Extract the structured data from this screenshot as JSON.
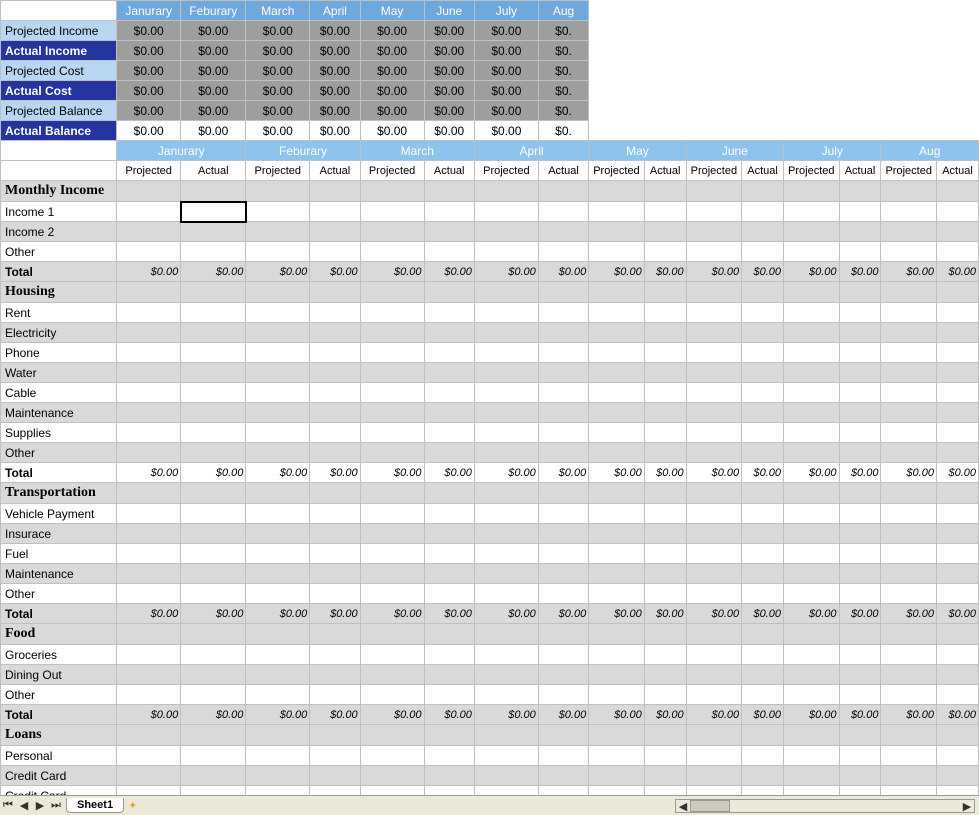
{
  "months": [
    "Janurary",
    "Feburary",
    "March",
    "April",
    "May",
    "June",
    "July",
    "Aug"
  ],
  "summary_rows": [
    {
      "label": "Projected Income",
      "style": "light",
      "vals": [
        "$0.00",
        "$0.00",
        "$0.00",
        "$0.00",
        "$0.00",
        "$0.00",
        "$0.00",
        "$0."
      ]
    },
    {
      "label": "Actual Income",
      "style": "dark",
      "vals": [
        "$0.00",
        "$0.00",
        "$0.00",
        "$0.00",
        "$0.00",
        "$0.00",
        "$0.00",
        "$0."
      ]
    },
    {
      "label": "Projected Cost",
      "style": "light",
      "vals": [
        "$0.00",
        "$0.00",
        "$0.00",
        "$0.00",
        "$0.00",
        "$0.00",
        "$0.00",
        "$0."
      ]
    },
    {
      "label": "Actual Cost",
      "style": "dark",
      "vals": [
        "$0.00",
        "$0.00",
        "$0.00",
        "$0.00",
        "$0.00",
        "$0.00",
        "$0.00",
        "$0."
      ]
    },
    {
      "label": "Projected Balance",
      "style": "light",
      "vals": [
        "$0.00",
        "$0.00",
        "$0.00",
        "$0.00",
        "$0.00",
        "$0.00",
        "$0.00",
        "$0."
      ]
    },
    {
      "label": "Actual Balance",
      "style": "dark",
      "white_body": true,
      "vals": [
        "$0.00",
        "$0.00",
        "$0.00",
        "$0.00",
        "$0.00",
        "$0.00",
        "$0.00",
        "$0."
      ]
    }
  ],
  "subcol_labels": {
    "projected": "Projected",
    "actual": "Actual"
  },
  "sections": [
    {
      "title": "Monthly Income",
      "items": [
        "Income 1",
        "Income 2",
        "Other"
      ],
      "has_total": true
    },
    {
      "title": "Housing",
      "items": [
        "Rent",
        "Electricity",
        "Phone",
        "Water",
        "Cable",
        "Maintenance",
        "Supplies",
        "Other"
      ],
      "has_total": true
    },
    {
      "title": "Transportation",
      "items": [
        "Vehicle Payment",
        "Insurace",
        "Fuel",
        "Maintenance",
        "Other"
      ],
      "has_total": true
    },
    {
      "title": "Food",
      "items": [
        "Groceries",
        "Dining Out",
        "Other"
      ],
      "has_total": true
    },
    {
      "title": "Loans",
      "items": [
        "Personal",
        "Credit Card",
        "Credit Card"
      ],
      "has_total": false
    }
  ],
  "total_label": "Total",
  "total_value": "$0.00",
  "selected_cell": {
    "section": 0,
    "item": 0,
    "col": 1
  },
  "sheet_tab": "Sheet1"
}
